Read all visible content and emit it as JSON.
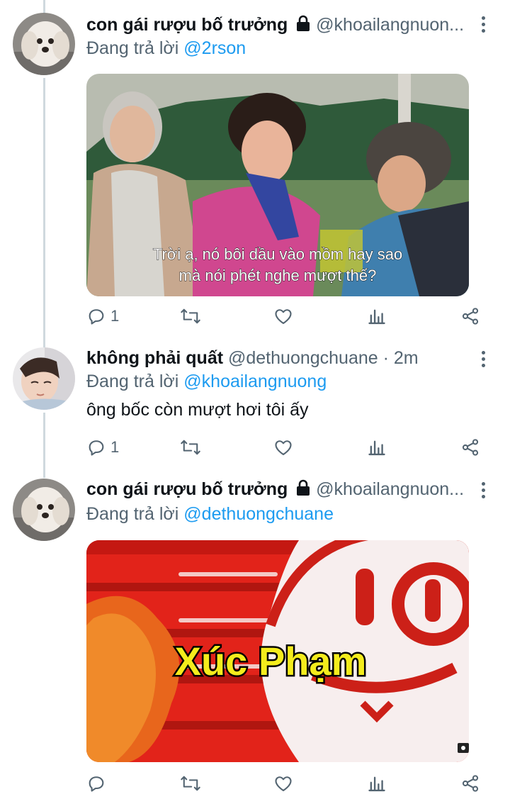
{
  "tweets": [
    {
      "display_name": "con gái rượu bố trưởng",
      "handle": "@khoailangnuon...",
      "time": "",
      "reply_prefix": "Đang trả lời",
      "reply_to": "@2rson",
      "text": "",
      "media_caption_line1": "Trời ạ, nó bôi dầu vào mồm hay sao",
      "media_caption_line2": "mà nói phét nghe mượt thế?",
      "reply_count": "1",
      "protected": true
    },
    {
      "display_name": "không phải quất",
      "handle": "@dethuongchuane",
      "time": "· 2m",
      "reply_prefix": "Đang trả lời",
      "reply_to": "@khoailangnuong",
      "text": "ông bốc còn mượt hơi tôi ấy",
      "reply_count": "1",
      "protected": false
    },
    {
      "display_name": "con gái rượu bố trưởng",
      "handle": "@khoailangnuon...",
      "time": "",
      "reply_prefix": "Đang trả lời",
      "reply_to": "@dethuongchuane",
      "text": "",
      "media_caption": "Xúc Phạm",
      "reply_count": "",
      "protected": true
    }
  ],
  "colors": {
    "text_primary": "#0f1419",
    "text_secondary": "#536471",
    "accent": "#1d9bf0",
    "thread_line": "#cfd9de"
  },
  "icons": [
    "reply-icon",
    "retweet-icon",
    "like-icon",
    "views-icon",
    "share-icon",
    "lock-icon",
    "more-icon"
  ]
}
